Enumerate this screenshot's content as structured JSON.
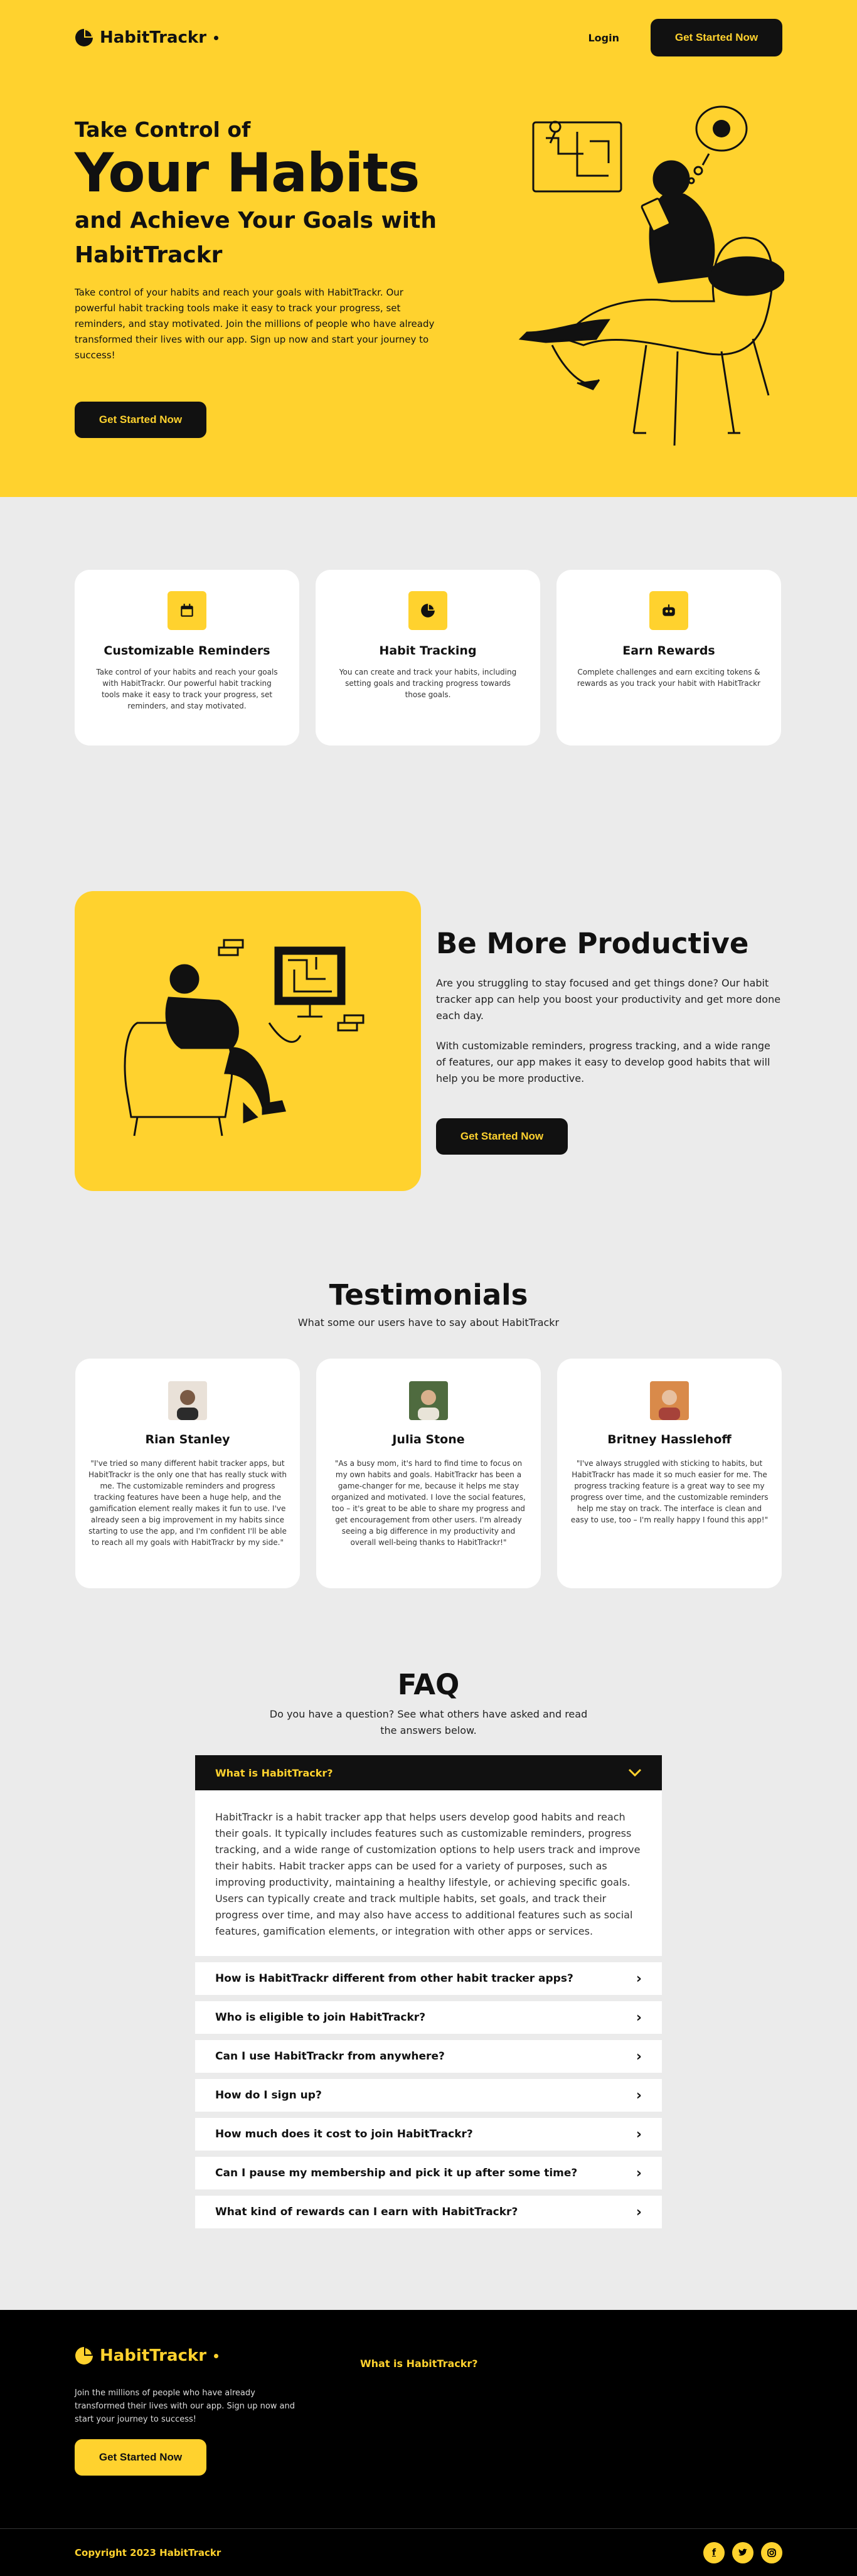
{
  "brand": {
    "name": "HabitTrackr",
    "accent": "#ffd22e",
    "dark": "#111111"
  },
  "nav": {
    "login": "Login",
    "cta": "Get Started Now"
  },
  "hero": {
    "line1": "Take Control of",
    "line2": "Your Habits",
    "line3": "and Achieve Your Goals with",
    "line4": "HabitTrackr",
    "paragraph": "Take control of your habits and reach your goals with HabitTrackr. Our powerful habit tracking tools make it easy to track your progress, set reminders, and stay motivated. Join the millions of people who have already transformed their lives with our app. Sign up now and start your journey to success!",
    "cta": "Get Started Now"
  },
  "features": [
    {
      "icon": "calendar-icon",
      "title": "Customizable Reminders",
      "text": "Take control of your habits and reach your goals with HabitTrackr. Our powerful habit tracking tools make it easy to track your progress, set reminders, and stay motivated."
    },
    {
      "icon": "pie-chart-icon",
      "title": "Habit Tracking",
      "text": "You can create and track your habits, including setting goals and tracking progress towards those goals."
    },
    {
      "icon": "robot-icon",
      "title": "Earn Rewards",
      "text": "Complete challenges and earn exciting tokens & rewards as you track your habit with HabitTrackr"
    }
  ],
  "productive": {
    "title": "Be More Productive",
    "p1": "Are you struggling to stay focused and get things done? Our habit tracker app can help you boost your productivity and get more done each day.",
    "p2": "With customizable reminders, progress tracking, and a wide range of features, our app makes it easy to develop good habits that will help you be more productive.",
    "cta": "Get Started Now"
  },
  "testimonials": {
    "title": "Testimonials",
    "subtitle": "What some our users have to say about HabitTrackr",
    "items": [
      {
        "name": "Rian Stanley",
        "quote": "\"I've tried so many different habit tracker apps, but HabitTrackr is the only one that has really stuck with me. The customizable reminders and progress tracking features have been a huge help, and the gamification element really makes it fun to use. I've already seen a big improvement in my habits since starting to use the app, and I'm confident I'll be able to reach all my goals with HabitTrackr by my side.\""
      },
      {
        "name": "Julia Stone",
        "quote": "\"As a busy mom, it's hard to find time to focus on my own habits and goals. HabitTrackr has been a game-changer for me, because it helps me stay organized and motivated. I love the social features, too – it's great to be able to share my progress and get encouragement from other users. I'm already seeing a big difference in my productivity and overall well-being thanks to HabitTrackr!\""
      },
      {
        "name": "Britney Hasslehoff",
        "quote": "\"I've always struggled with sticking to habits, but HabitTrackr has made it so much easier for me. The progress tracking feature is a great way to see my progress over time, and the customizable reminders help me stay on track. The interface is clean and easy to use, too – I'm really happy I found this app!\""
      }
    ]
  },
  "faq": {
    "title": "FAQ",
    "subtitle": "Do you have a question? See what others have asked and read the answers below.",
    "open_question": "What is HabitTrackr?",
    "open_answer": "HabitTrackr is a habit tracker app that helps users develop good habits and reach their goals. It typically includes features such as customizable reminders, progress tracking, and a wide range of customization options to help users track and improve their habits. Habit tracker apps can be used for a variety of purposes, such as improving productivity, maintaining a healthy lifestyle, or achieving specific goals. Users can typically create and track multiple habits, set goals, and track their progress over time, and may also have access to additional features such as social features, gamification elements, or integration with other apps or services.",
    "questions": [
      "How is HabitTrackr different from other habit tracker apps?",
      "Who is eligible to join HabitTrackr?",
      "Can I use HabitTrackr from anywhere?",
      "How do I sign up?",
      "How much does it cost to join HabitTrackr?",
      "Can I pause my membership and pick it up after some time?",
      "What kind of rewards can I earn with HabitTrackr?"
    ]
  },
  "footer": {
    "text": "Join the millions of people who have already transformed their lives with our app. Sign up now and start your journey to success!",
    "link": "What is HabitTrackr?",
    "cta": "Get Started Now",
    "copyright": "Copyright 2023 HabitTrackr",
    "socials": [
      "facebook-icon",
      "twitter-icon",
      "instagram-icon"
    ]
  }
}
